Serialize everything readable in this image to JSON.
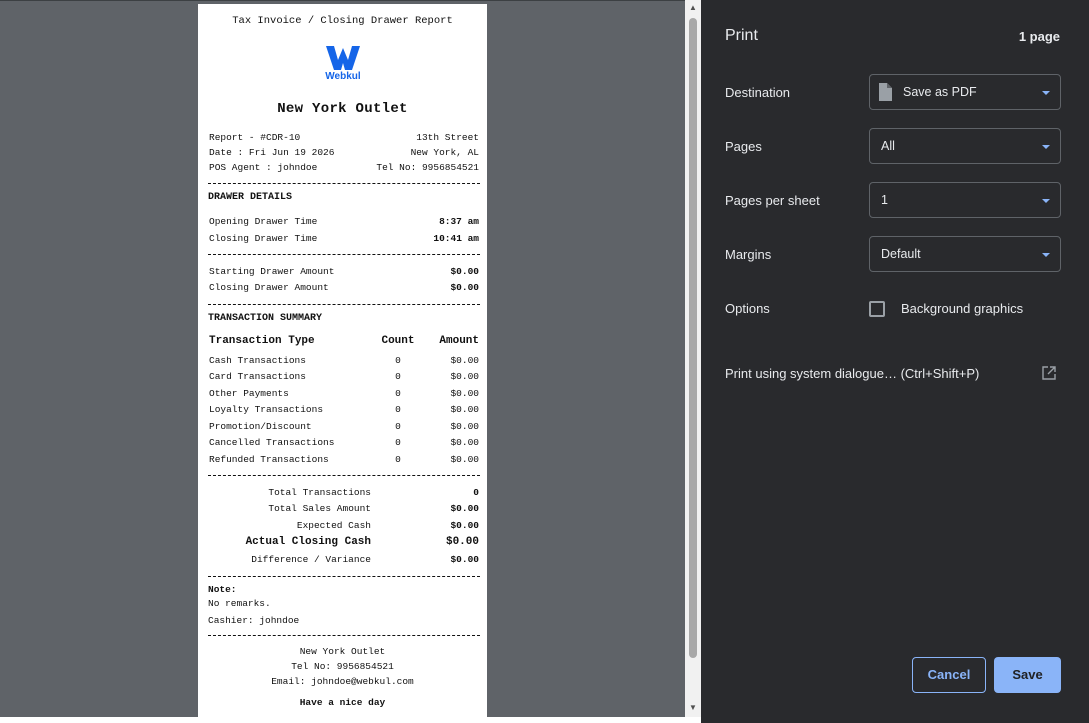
{
  "receipt": {
    "header_title": "Tax Invoice / Closing Drawer Report",
    "logo_text": "Webkul",
    "outlet_name": "New York Outlet",
    "info": [
      {
        "left": "Report - #CDR-10",
        "right": "13th Street"
      },
      {
        "left": "Date : Fri Jun 19 2026",
        "right": "New York, AL"
      },
      {
        "left": "POS Agent : johndoe",
        "right": "Tel No: 9956854521"
      }
    ],
    "drawer_section_title": "DRAWER DETAILS",
    "drawer_times": [
      {
        "label": "Opening Drawer Time",
        "value": "8:37 am"
      },
      {
        "label": "Closing Drawer Time",
        "value": "10:41 am"
      }
    ],
    "drawer_amounts": [
      {
        "label": "Starting Drawer Amount",
        "value": "$0.00"
      },
      {
        "label": "Closing Drawer Amount",
        "value": "$0.00"
      }
    ],
    "txn_section_title": "TRANSACTION SUMMARY",
    "txn_headers": {
      "type": "Transaction Type",
      "count": "Count",
      "amount": "Amount"
    },
    "transactions": [
      {
        "type": "Cash Transactions",
        "count": "0",
        "amount": "$0.00"
      },
      {
        "type": "Card Transactions",
        "count": "0",
        "amount": "$0.00"
      },
      {
        "type": "Other Payments",
        "count": "0",
        "amount": "$0.00"
      },
      {
        "type": "Loyalty Transactions",
        "count": "0",
        "amount": "$0.00"
      },
      {
        "type": "Promotion/Discount",
        "count": "0",
        "amount": "$0.00"
      },
      {
        "type": "Cancelled Transactions",
        "count": "0",
        "amount": "$0.00"
      },
      {
        "type": "Refunded Transactions",
        "count": "0",
        "amount": "$0.00"
      }
    ],
    "totals": [
      {
        "label": "Total Transactions",
        "value": "0"
      },
      {
        "label": "Total Sales Amount",
        "value": "$0.00"
      },
      {
        "label": "Expected Cash",
        "value": "$0.00"
      },
      {
        "label": "Actual Closing Cash",
        "value": "$0.00"
      },
      {
        "label": "Difference / Variance",
        "value": "$0.00"
      }
    ],
    "note_label": "Note:",
    "note_text": "No remarks.",
    "cashier": "Cashier: johndoe",
    "footer_outlet": "New York Outlet",
    "footer_tel": "Tel No: 9956854521",
    "footer_email": "Email: johndoe@webkul.com",
    "footer_greeting": "Have a nice day"
  },
  "print_panel": {
    "title": "Print",
    "page_count": "1 page",
    "destination_label": "Destination",
    "destination_value": "Save as PDF",
    "pages_label": "Pages",
    "pages_value": "All",
    "pages_per_sheet_label": "Pages per sheet",
    "pages_per_sheet_value": "1",
    "margins_label": "Margins",
    "margins_value": "Default",
    "options_label": "Options",
    "background_graphics_label": "Background graphics",
    "system_dialog_label": "Print using system dialogue… (Ctrl+Shift+P)",
    "cancel_label": "Cancel",
    "save_label": "Save"
  },
  "colors": {
    "accent": "#8ab4f8",
    "panel_bg": "#292a2d",
    "preview_bg": "#5f6368",
    "logo_blue": "#1565e8"
  },
  "icons": {
    "document": "document-icon",
    "external_link": "open-in-new-icon",
    "dropdown": "caret-down-icon",
    "logo": "webkul-logo"
  }
}
